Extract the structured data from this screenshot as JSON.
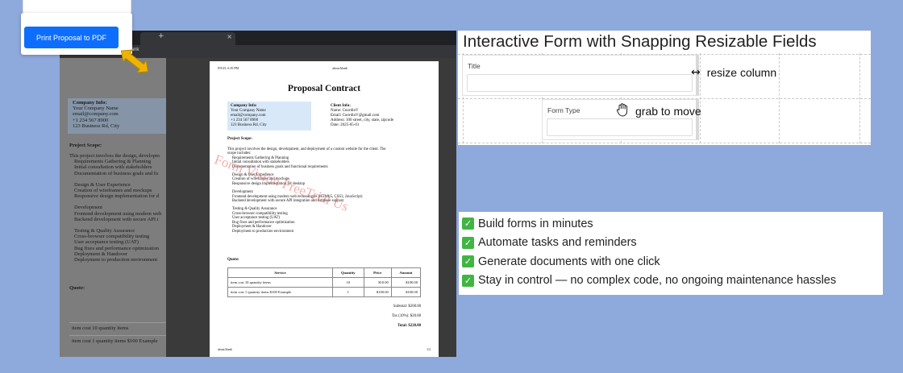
{
  "browser": {
    "tab_close": "×",
    "tab_add": "+",
    "blank_label": "blank"
  },
  "print_button_label": "Print Proposal to PDF",
  "background_doc": {
    "company_heading": "Company Info:",
    "company_lines": [
      "Your Company Name",
      "email@company.com",
      "+1 234 567 8900",
      "123 Business Rd, City"
    ],
    "scope_heading": "Project Scope:",
    "scope_lines": [
      {
        "t": "This project involves the design, developm",
        "i": false
      },
      {
        "t": "Requirements Gathering & Planning",
        "i": true
      },
      {
        "t": "Initial consultation with stakeholders",
        "i": true
      },
      {
        "t": "Documentation of business goals and fu",
        "i": true
      },
      {
        "t": "",
        "i": false
      },
      {
        "t": "Design & User Experience",
        "i": true
      },
      {
        "t": "Creation of wireframes and mockups",
        "i": true
      },
      {
        "t": "Responsive design implementation for d",
        "i": true
      },
      {
        "t": "",
        "i": false
      },
      {
        "t": "Development",
        "i": true
      },
      {
        "t": "Frontend development using modern web",
        "i": true
      },
      {
        "t": "Backend development with secure API i",
        "i": true
      },
      {
        "t": "",
        "i": false
      },
      {
        "t": "Testing & Quality Assurance",
        "i": true
      },
      {
        "t": "Cross-browser compatibility testing",
        "i": true
      },
      {
        "t": "User acceptance testing (UAT)",
        "i": true
      },
      {
        "t": "Bug fixes and performance optimization",
        "i": true
      },
      {
        "t": "Deployment & Handover",
        "i": true
      },
      {
        "t": "Deployment to production environment",
        "i": true
      }
    ],
    "quote_heading": "Quote:",
    "quote_rows": [
      "item cost 10 quantity items",
      "item cost 1 quantity items $100 Example"
    ]
  },
  "paper": {
    "header_date": "8/9/25, 6:39 PM",
    "header_name": "about:blank",
    "title": "Proposal Contract",
    "company_heading": "Company Info:",
    "company_lines": [
      "Your Company Name",
      "email@company.com",
      "+1 234 567 8900",
      "123 Business Rd, City"
    ],
    "client_heading": "Client Info:",
    "client_lines": [
      "Name: CoordinV",
      "Email: CoordinV@gmail.com",
      "Address: 100 street, city, state, zipcode",
      "Date: 2025-05-01"
    ],
    "scope_heading": "Project Scope:",
    "scope_lines": [
      {
        "t": "This project involves the design, development, and deployment of a custom website for the client. The",
        "i": false
      },
      {
        "t": "scope includes:",
        "i": false
      },
      {
        "t": "Requirements Gathering & Planning",
        "i": true
      },
      {
        "t": "Initial consultation with stakeholders",
        "i": true
      },
      {
        "t": "Documentation of business goals and functional requirements",
        "i": true
      },
      {
        "t": "",
        "i": false
      },
      {
        "t": "Design & User Experience",
        "i": true
      },
      {
        "t": "Creation of wireframes and mockups",
        "i": true
      },
      {
        "t": "Responsive design implementation for desktop",
        "i": true
      },
      {
        "t": "",
        "i": false
      },
      {
        "t": "Development",
        "i": true
      },
      {
        "t": "Frontend development using modern web technologies (HTML5, CSS3, JavaScript)",
        "i": true
      },
      {
        "t": "Backend development with secure API integration and database support",
        "i": true
      },
      {
        "t": "",
        "i": false
      },
      {
        "t": "Testing & Quality Assurance",
        "i": true
      },
      {
        "t": "Cross-browser compatibility testing",
        "i": true
      },
      {
        "t": "User acceptance testing (UAT)",
        "i": true
      },
      {
        "t": "Bug fixes and performance optimization",
        "i": true
      },
      {
        "t": "Deployment & Handover",
        "i": true
      },
      {
        "t": "Deployment to production environment",
        "i": true
      }
    ],
    "quote_heading": "Quote:",
    "table_headers": [
      "Service",
      "Quantity",
      "Price",
      "Amount"
    ],
    "table_rows": [
      [
        "item cost 10 quantity items",
        "10",
        "$10.00",
        "$100.00"
      ],
      [
        "item cost 1 quantity items $100 Example",
        "1",
        "$100.00",
        "$100.00"
      ]
    ],
    "subtotal": "Subtotal: $200.00",
    "tax": "Tax (10%): $20.00",
    "total": "Total: $220.00",
    "footer_left": "about:blank",
    "footer_right": "1/2",
    "watermark": "Form Vision FreeTrial Us"
  },
  "form_demo": {
    "title": "Interactive Form with Snapping Resizable Fields",
    "field_title_label": "Title",
    "field_form_type_label": "Form Type",
    "resize_hint": "resize column",
    "resize_icon": "↔",
    "move_hint": "grab to move",
    "move_icon": "hand-grab-icon"
  },
  "benefits": [
    "Build forms in minutes",
    "Automate tasks and reminders",
    "Generate documents with one click",
    "Stay in control — no complex code, no ongoing maintenance hassles"
  ],
  "colors": {
    "background": "#8ea9dc",
    "print_button": "#0d6efd",
    "arrow": "#f0b400",
    "check": "#40b543",
    "company_box": "#d8e8f8",
    "watermark": "#e66e6e"
  }
}
